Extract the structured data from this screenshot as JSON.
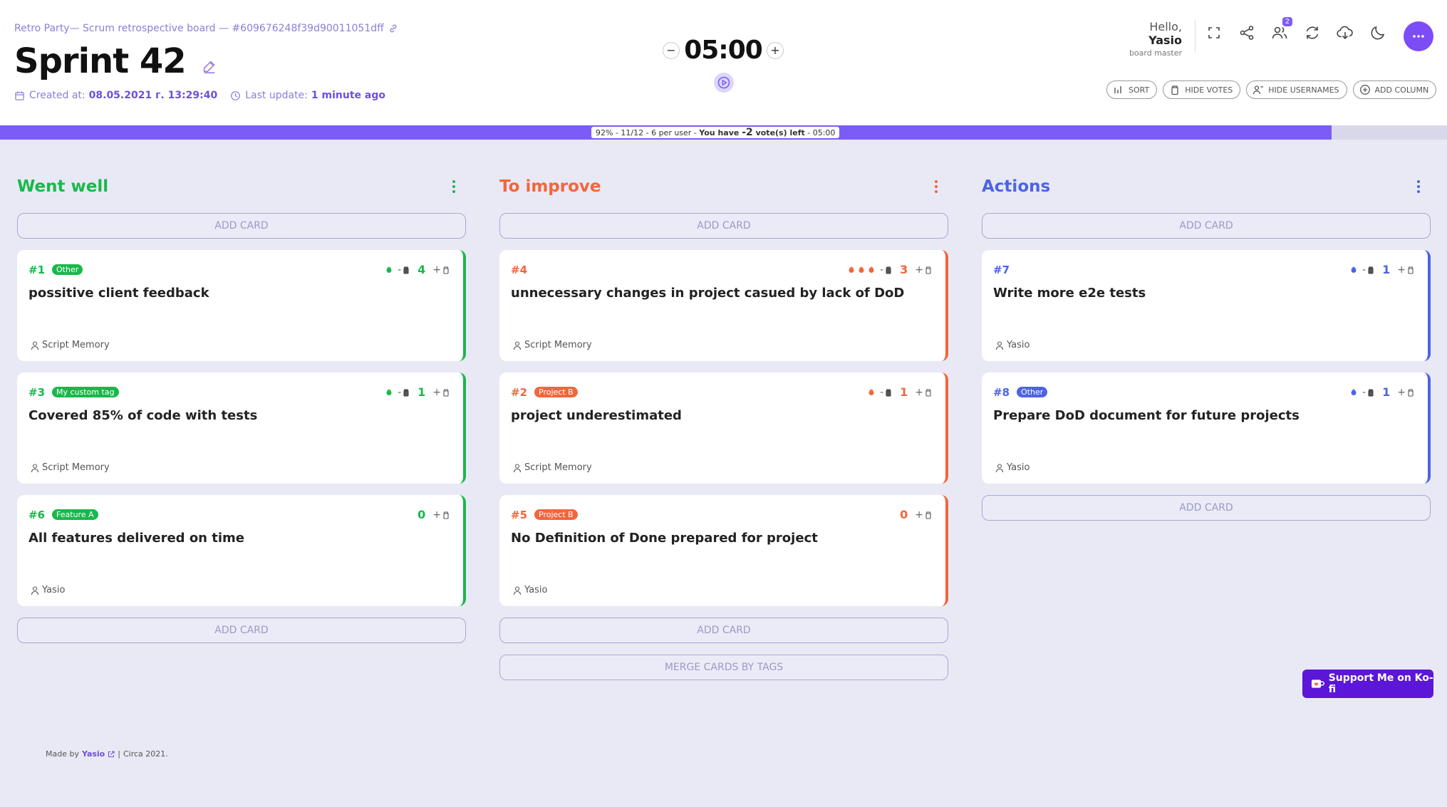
{
  "header": {
    "breadcrumb": "Retro Party— Scrum retrospective board — #609676248f39d90011051dff",
    "title": "Sprint 42",
    "created_label": "Created at:",
    "created_value": "08.05.2021 г. 13:29:40",
    "updated_label": "Last update:",
    "updated_value": "1 minute ago"
  },
  "timer": {
    "value": "05:00",
    "minus": "−",
    "plus": "+"
  },
  "user": {
    "hello": "Hello,",
    "name": "Yasio",
    "role": "board master",
    "users_badge": "2"
  },
  "toolbar": {
    "icons": [
      "fullscreen-icon",
      "share-icon",
      "users-icon",
      "refresh-icon",
      "download-icon",
      "dark-mode-icon",
      "more-icon"
    ],
    "sort": "SORT",
    "hide_votes": "HIDE VOTES",
    "hide_usernames": "HIDE USERNAMES",
    "add_column": "ADD COLUMN"
  },
  "progress": {
    "percent": 92,
    "text_a": "92% - 11/12 - 6 per user - ",
    "text_b": "You have ",
    "text_c": "-2",
    "text_d": " vote(s) left",
    "text_e": " - 05:00"
  },
  "columns": [
    {
      "title": "Went well",
      "color": "#19b84b",
      "add_card": "ADD CARD",
      "cards": [
        {
          "num": "#1",
          "tag": "Other",
          "votes": "4",
          "text": "possitive client feedback",
          "author": "Script Memory",
          "dots": 1,
          "minus": "-",
          "plus": "+"
        },
        {
          "num": "#3",
          "tag": "My custom tag",
          "votes": "1",
          "text": "Covered 85% of code with tests",
          "author": "Script Memory",
          "dots": 1,
          "minus": "-",
          "plus": "+"
        },
        {
          "num": "#6",
          "tag": "Feature A",
          "votes": "0",
          "text": "All features delivered on time",
          "author": "Yasio",
          "dots": 0,
          "minus": "",
          "plus": "+"
        }
      ]
    },
    {
      "title": "To improve",
      "color": "#f2663b",
      "add_card": "ADD CARD",
      "merge": "MERGE CARDS BY TAGS",
      "cards": [
        {
          "num": "#4",
          "tag": "",
          "votes": "3",
          "text": "unnecessary changes in project casued by lack of DoD",
          "author": "Script Memory",
          "dots": 3,
          "minus": "-",
          "plus": "+"
        },
        {
          "num": "#2",
          "tag": "Project B",
          "votes": "1",
          "text": "project underestimated",
          "author": "Script Memory",
          "dots": 1,
          "minus": "-",
          "plus": "+"
        },
        {
          "num": "#5",
          "tag": "Project B",
          "votes": "0",
          "text": "No Definition of Done prepared for project",
          "author": "Yasio",
          "dots": 0,
          "minus": "",
          "plus": "+"
        }
      ]
    },
    {
      "title": "Actions",
      "color": "#4c63e6",
      "add_card": "ADD CARD",
      "cards": [
        {
          "num": "#7",
          "tag": "",
          "votes": "1",
          "text": "Write more e2e tests",
          "author": "Yasio",
          "dots": 1,
          "minus": "-",
          "plus": "+"
        },
        {
          "num": "#8",
          "tag": "Other",
          "votes": "1",
          "text": "Prepare DoD document for future projects",
          "author": "Yasio",
          "dots": 1,
          "minus": "-",
          "plus": "+"
        }
      ]
    }
  ],
  "kofi": "Support Me on Ko-fi",
  "footer": {
    "made_by": "Made by",
    "author": "Yasio",
    "sep": "|",
    "circa": "Circa 2021."
  }
}
